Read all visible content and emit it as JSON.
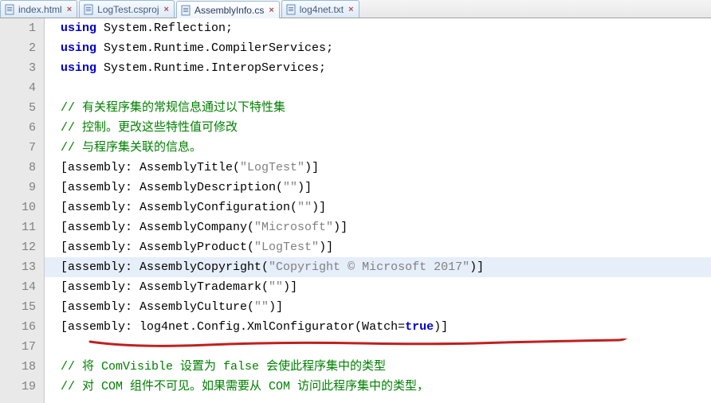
{
  "tabs": [
    {
      "label": "index.html",
      "active": false
    },
    {
      "label": "LogTest.csproj",
      "active": false
    },
    {
      "label": "AssemblyInfo.cs",
      "active": true
    },
    {
      "label": "log4net.txt",
      "active": false
    }
  ],
  "gutter_start": 1,
  "gutter_end": 19,
  "code": {
    "l1_kw": "using",
    "l1_rest": " System.Reflection;",
    "l2_kw": "using",
    "l2_rest": " System.Runtime.CompilerServices;",
    "l3_kw": "using",
    "l3_rest": " System.Runtime.InteropServices;",
    "l5_cm": "// 有关程序集的常规信息通过以下特性集",
    "l6_cm": "// 控制。更改这些特性值可修改",
    "l7_cm": "// 与程序集关联的信息。",
    "l8_a": "[assembly: AssemblyTitle(",
    "l8_s": "\"LogTest\"",
    "l8_b": ")]",
    "l9_a": "[assembly: AssemblyDescription(",
    "l9_s": "\"\"",
    "l9_b": ")]",
    "l10_a": "[assembly: AssemblyConfiguration(",
    "l10_s": "\"\"",
    "l10_b": ")]",
    "l11_a": "[assembly: AssemblyCompany(",
    "l11_s": "\"Microsoft\"",
    "l11_b": ")]",
    "l12_a": "[assembly: AssemblyProduct(",
    "l12_s": "\"LogTest\"",
    "l12_b": ")]",
    "l13_a": "[assembly: AssemblyCopyright(",
    "l13_s": "\"Copyright © Microsoft 2017\"",
    "l13_b": ")]",
    "l14_a": "[assembly: AssemblyTrademark(",
    "l14_s": "\"\"",
    "l14_b": ")]",
    "l15_a": "[assembly: AssemblyCulture(",
    "l15_s": "\"\"",
    "l15_b": ")]",
    "l16_a": "[assembly: log4net.Config.XmlConfigurator(Watch=",
    "l16_kw": "true",
    "l16_b": ")]",
    "l18_cm": "// 将 ComVisible 设置为 false 会使此程序集中的类型",
    "l19_cm": "// 对 COM 组件不可见。如果需要从 COM 访问此程序集中的类型，"
  }
}
